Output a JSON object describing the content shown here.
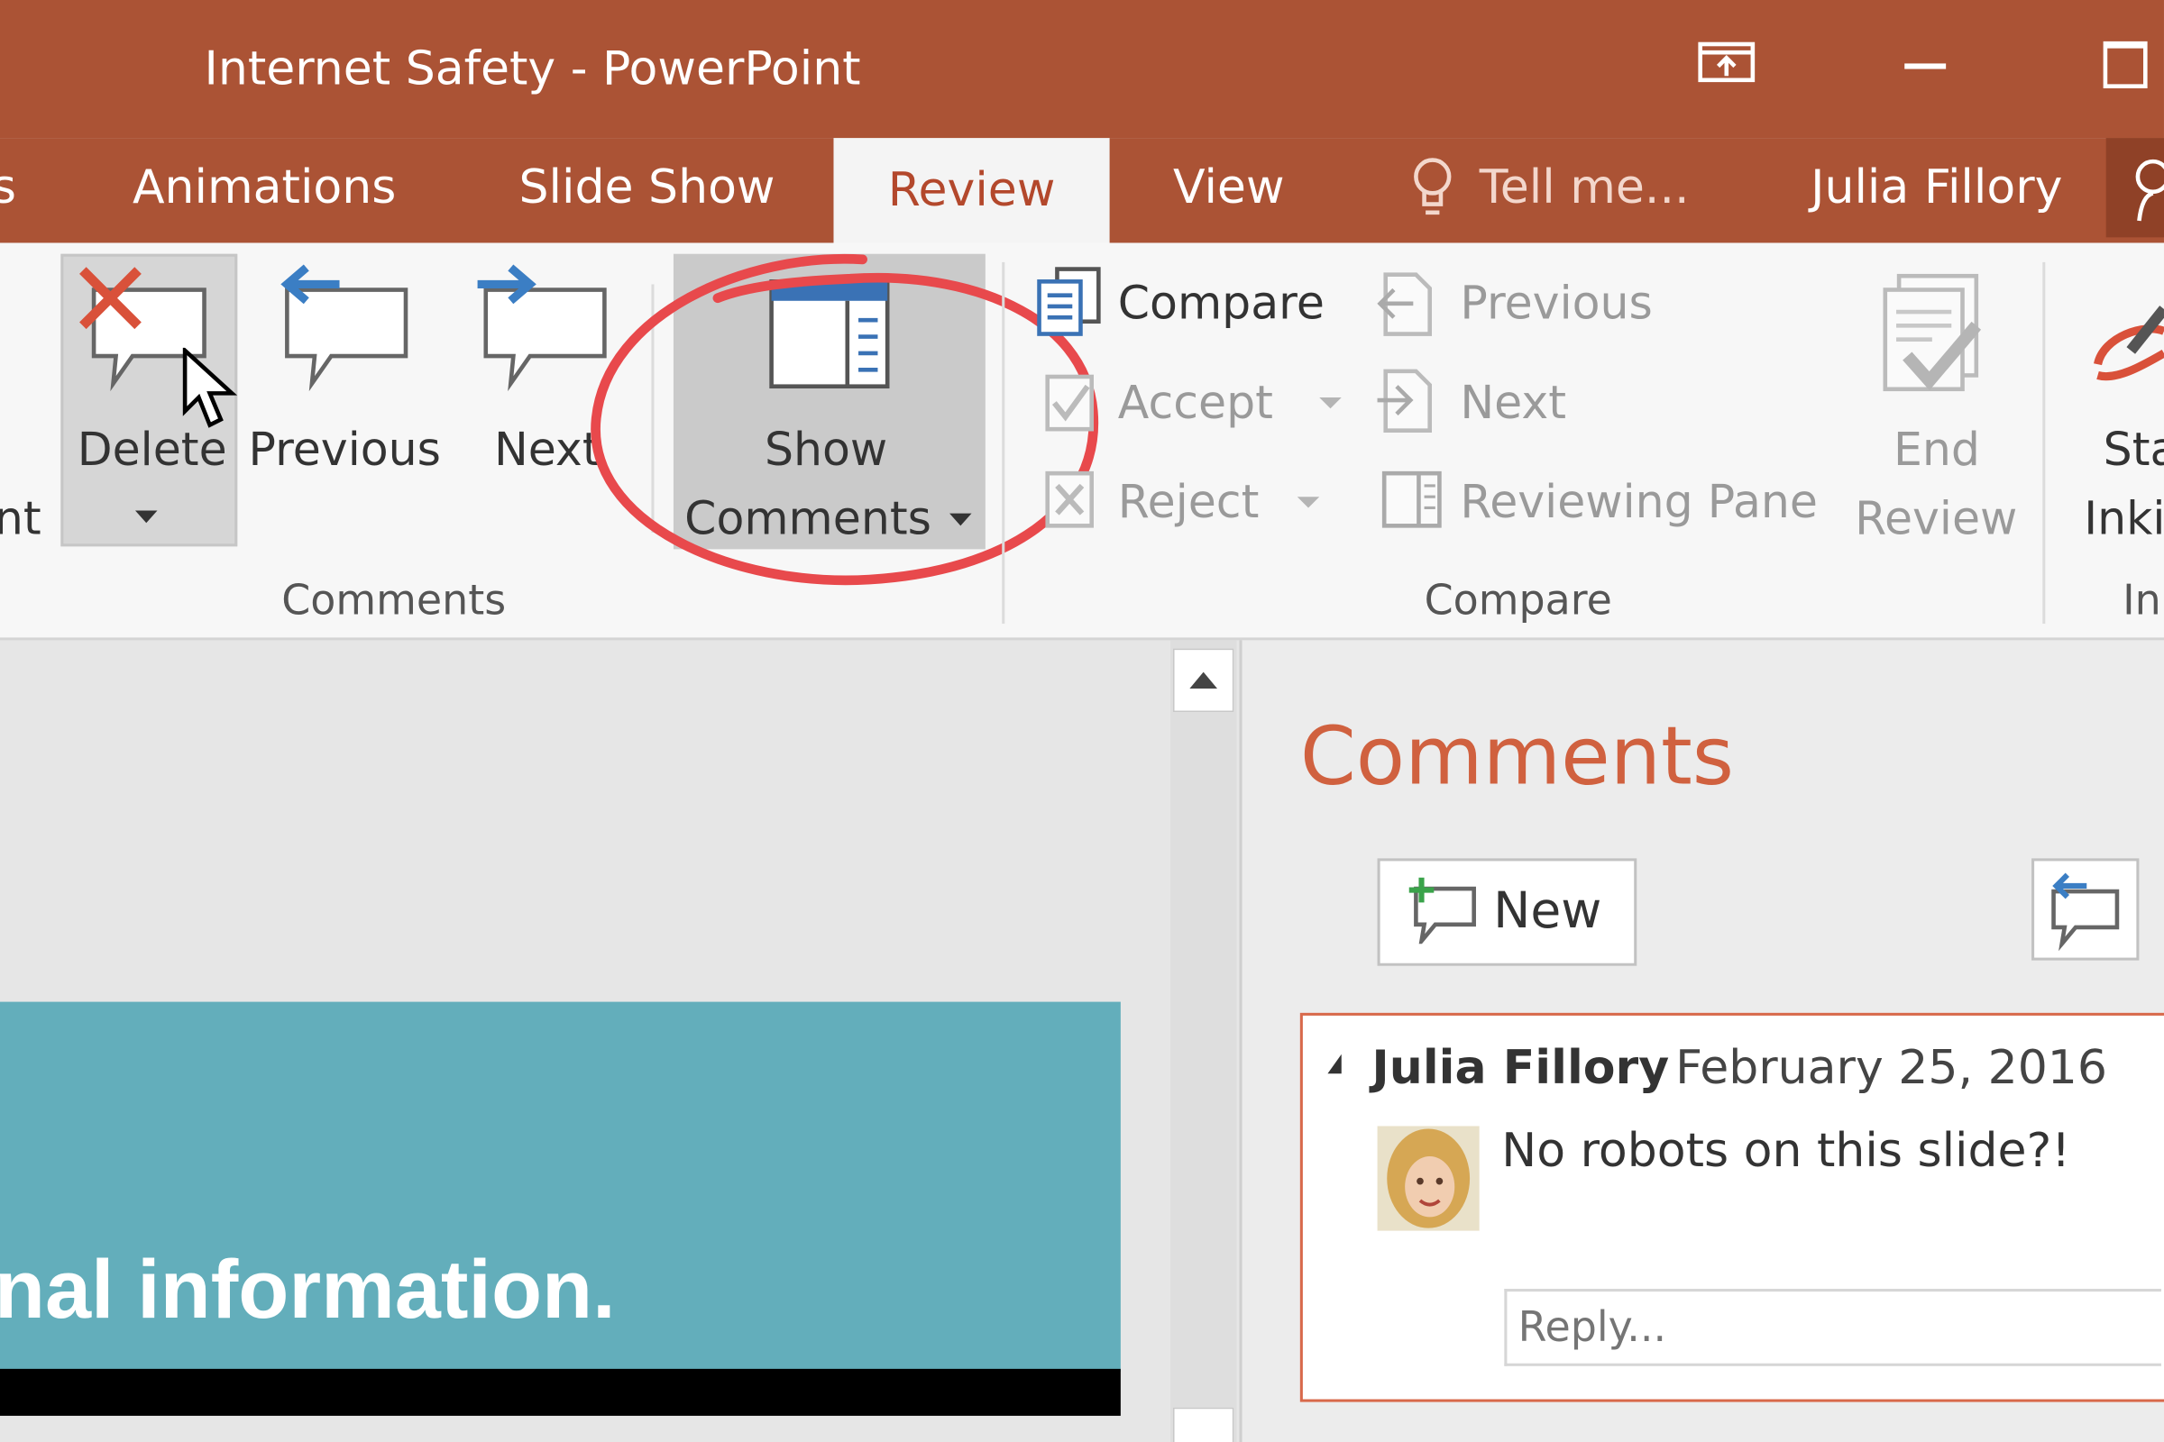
{
  "window": {
    "title": "Internet Safety - PowerPoint"
  },
  "tabs": {
    "partial_left": "s",
    "animations": "Animations",
    "slide_show": "Slide Show",
    "review": "Review",
    "view": "View",
    "tell_me": "Tell me...",
    "user": "Julia Fillory"
  },
  "ribbon": {
    "comments_group": {
      "label": "Comments",
      "partial_left": "nt",
      "delete": "Delete",
      "previous": "Previous",
      "next": "Next",
      "show_line1": "Show",
      "show_line2": "Comments"
    },
    "compare_group": {
      "label": "Compare",
      "compare": "Compare",
      "accept": "Accept",
      "reject": "Reject",
      "previous": "Previous",
      "next": "Next",
      "reviewing_pane": "Reviewing Pane",
      "end_line1": "End",
      "end_line2": "Review"
    },
    "ink_group": {
      "label_partial": "In",
      "start_line1": "Sta",
      "start_line2": "Inki"
    }
  },
  "slide": {
    "text_partial": "nal information."
  },
  "comments_pane": {
    "title": "Comments",
    "new_button": "New",
    "comment": {
      "author": "Julia Fillory",
      "date": "February 25, 2016",
      "text": "No robots on this slide?!",
      "reply_placeholder": "Reply..."
    }
  },
  "colors": {
    "accent": "#ab5335",
    "highlight_circle": "#e8494c",
    "slide_bg": "#63aebb"
  }
}
